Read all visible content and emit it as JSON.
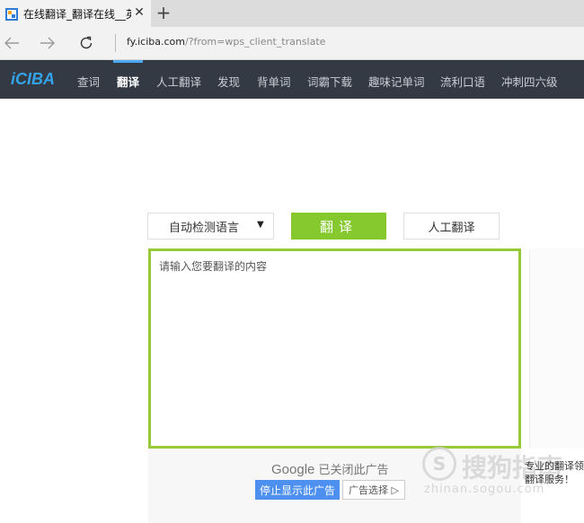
{
  "browser": {
    "tab_title": "在线翻译_翻译在线__英",
    "tab_close": "✕",
    "new_tab": "+",
    "url_host": "fy.iciba.com",
    "url_path": "/?from=wps_client_translate",
    "url_prefix": "fy."
  },
  "site": {
    "logo": "iCIBA",
    "nav": [
      {
        "label": "查词"
      },
      {
        "label": "翻译"
      },
      {
        "label": "人工翻译"
      },
      {
        "label": "发现"
      },
      {
        "label": "背单词"
      },
      {
        "label": "词霸下载"
      },
      {
        "label": "趣味记单词"
      },
      {
        "label": "流利口语"
      },
      {
        "label": "冲刺四六级"
      }
    ],
    "active_nav": "翻译"
  },
  "translator": {
    "language_select": "自动检测语言",
    "translate_button": "翻译",
    "human_button": "人工翻译",
    "input_placeholder": "请输入您要翻译的内容"
  },
  "ad": {
    "google": "Google",
    "closed_text": "已关闭此广告",
    "stop_button": "停止显示此广告",
    "choice_button": "广告选择 ▷"
  },
  "promo": {
    "line1": "专业的翻译领",
    "line2": "翻译服务！"
  },
  "watermark": {
    "text": "搜狗指南",
    "url": "zhinan.sogou.com"
  },
  "colors": {
    "navbar": "#333a44",
    "accent_green": "#85c92f",
    "textarea_border": "#97c93c",
    "link_blue": "#4d90f0"
  }
}
